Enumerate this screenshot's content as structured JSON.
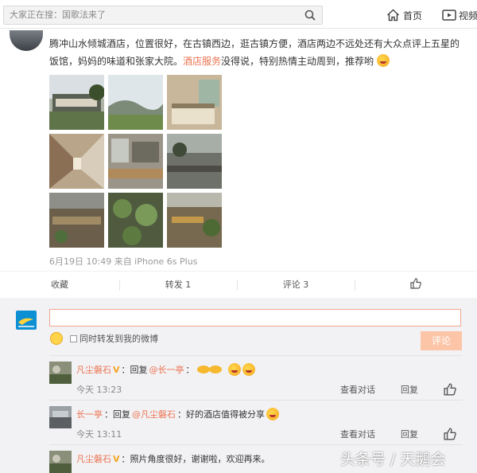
{
  "search": {
    "placeholder": "大家正在搜：国歌法来了"
  },
  "nav": {
    "home_label": "首页",
    "video_label": "视频"
  },
  "post": {
    "text_a": "腾冲山水倾城酒店，位置很好，在古镇西边，逛古镇方便，酒店两边不远处还有大众点评上五星的饭馆，妈妈的味道和张家大院。",
    "link": "酒店服务",
    "text_b": "没得说，特别热情主动周到，推荐哟",
    "meta": "6月19日 10:49 来自 iPhone 6s Plus"
  },
  "actions": {
    "collect": "收藏",
    "forward": "转发 1",
    "comment": "评论 3"
  },
  "composer": {
    "forward_label": "同时转发到我的微博",
    "submit_label": "评论"
  },
  "comments": [
    {
      "user": "凡尘磐石",
      "prefix": "：回复",
      "mention": "@长一亭",
      "text": "：",
      "time": "今天 13:23",
      "view": "查看对话",
      "reply": "回复"
    },
    {
      "user": "长一亭",
      "prefix": "：回复",
      "mention": "@凡尘磐石",
      "text": "：好的酒店值得被分享",
      "time": "今天 13:11",
      "view": "查看对话",
      "reply": "回复"
    },
    {
      "user": "凡尘磐石",
      "prefix": "：照片角度很好，谢谢啦，欢迎再来。",
      "mention": "",
      "text": "",
      "time": ""
    }
  ],
  "watermark": "头条号 / 天鹅会"
}
